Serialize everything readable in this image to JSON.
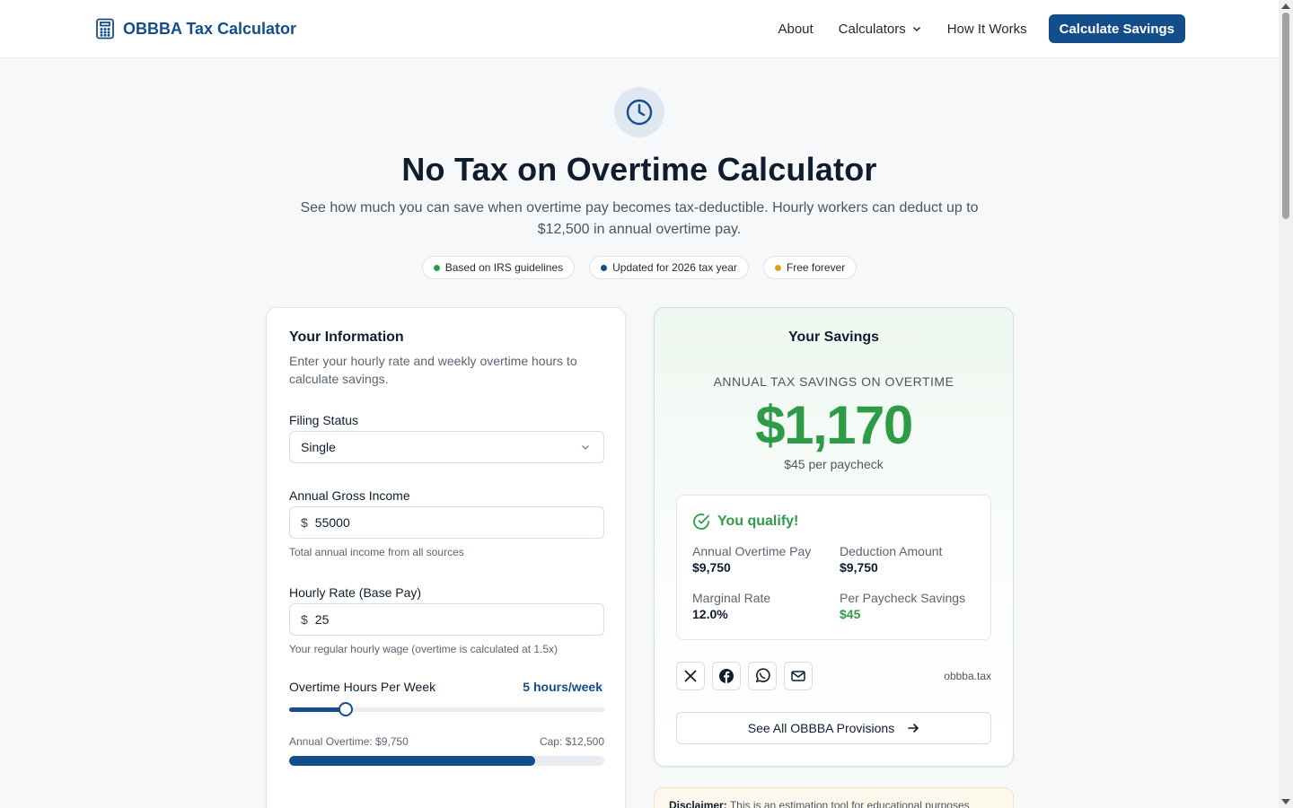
{
  "header": {
    "brand": "OBBBA Tax Calculator",
    "nav": {
      "about": "About",
      "calculators": "Calculators",
      "how_it_works": "How It Works",
      "cta": "Calculate Savings"
    }
  },
  "hero": {
    "icon": "clock-icon",
    "title": "No Tax on Overtime Calculator",
    "subtitle": "See how much you can save when overtime pay becomes tax-deductible. Hourly workers can deduct up to $12,500 in annual overtime pay.",
    "badges": [
      {
        "label": "Based on IRS guidelines",
        "color": "#2e9c47"
      },
      {
        "label": "Updated for 2026 tax year",
        "color": "#134e8a"
      },
      {
        "label": "Free forever",
        "color": "#e0a21a"
      }
    ]
  },
  "form": {
    "title": "Your Information",
    "description": "Enter your hourly rate and weekly overtime hours to calculate savings.",
    "filing_status": {
      "label": "Filing Status",
      "value": "Single"
    },
    "income": {
      "label": "Annual Gross Income",
      "currency": "$",
      "value": "55000",
      "hint": "Total annual income from all sources"
    },
    "hourly": {
      "label": "Hourly Rate (Base Pay)",
      "currency": "$",
      "value": "25",
      "hint": "Your regular hourly wage (overtime is calculated at 1.5x)"
    },
    "overtime": {
      "label": "Overtime Hours Per Week",
      "value_text": "5 hours/week",
      "slider_fraction": 0.18
    },
    "annual_overtime_text": "Annual Overtime: $9,750",
    "cap_text": "Cap: $12,500",
    "cap_fraction": 0.78
  },
  "results": {
    "title": "Your Savings",
    "annual_label": "ANNUAL TAX SAVINGS ON OVERTIME",
    "annual_value": "$1,170",
    "per_paycheck": "$45 per paycheck",
    "qualify_text": "You qualify!",
    "stats": {
      "overtime_pay": {
        "label": "Annual Overtime Pay",
        "value": "$9,750"
      },
      "deduction": {
        "label": "Deduction Amount",
        "value": "$9,750"
      },
      "marginal": {
        "label": "Marginal Rate",
        "value": "12.0%"
      },
      "per_paycheck": {
        "label": "Per Paycheck Savings",
        "value": "$45"
      }
    },
    "share_site": "obbba.tax",
    "provisions_label": "See All OBBBA Provisions"
  },
  "disclaimer": {
    "bold": "Disclaimer:",
    "text": "This is an estimation tool for educational purposes"
  }
}
